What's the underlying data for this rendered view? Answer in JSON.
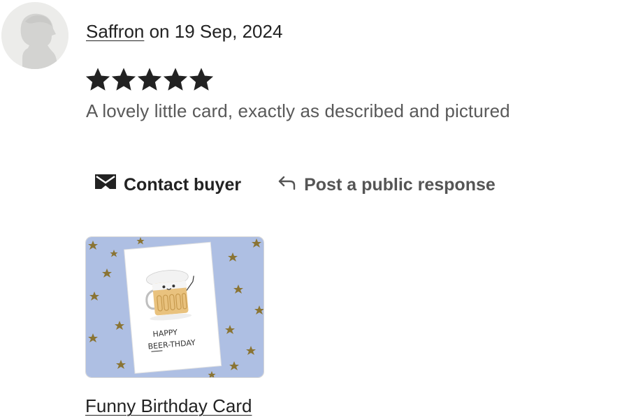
{
  "review": {
    "reviewer_name": "Saffron",
    "date_prefix": " on ",
    "date": "19 Sep, 2024",
    "rating": 5,
    "rating_max": 5,
    "text": "A lovely little card, exactly as described and pictured"
  },
  "actions": {
    "contact_label": "Contact buyer",
    "contact_icon": "envelope-icon",
    "respond_label": "Post a public response",
    "respond_icon": "reply-arrow-icon"
  },
  "product": {
    "title": "Funny Birthday Card",
    "card_line1": "HAPPY",
    "card_line2": "BEER-THDAY"
  },
  "colors": {
    "star": "#222222",
    "thumb_background": "#aebfe3",
    "text_muted": "#595959"
  }
}
